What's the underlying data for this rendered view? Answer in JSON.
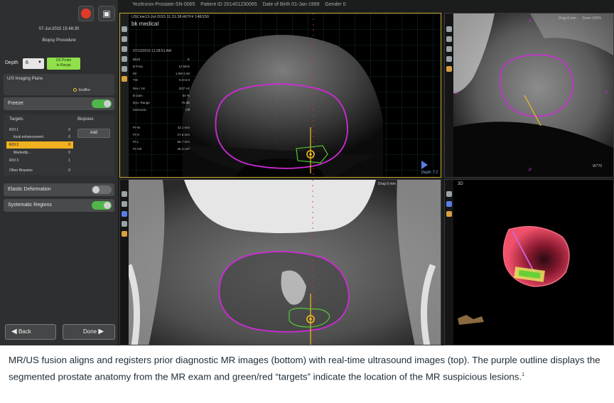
{
  "window": {
    "title": "Yezitronix-Prostate-SN-0065",
    "patient_id": "Patient ID 201401230065",
    "dob": "Date of Birth 01-Jan-1999",
    "gender": "Gender 0"
  },
  "panel": {
    "date": "07-Jul-2015 15:48:30",
    "procedure": "Biopsy Procedure",
    "camera_icon": "camera-icon",
    "depth_label": "Depth",
    "depth_value": "6",
    "probe_badge_line1": "US Probe",
    "probe_badge_line2": "In Range",
    "imaging_plane_title": "U/S Imaging Plane",
    "imaging_plane_option": "Endfire",
    "freeze_label": "Freeze",
    "freeze_on": true,
    "targets_header": "Targets",
    "biopsies_header": "Biopsies",
    "add_label": "Add",
    "targets": [
      {
        "name": "ROI 1",
        "count": "0",
        "selected": false
      },
      {
        "name": "local enhancement",
        "count": "0",
        "selected": false
      },
      {
        "name": "ROI 2",
        "count": "0",
        "selected": true
      },
      {
        "name": "Markedly...",
        "count": "0",
        "selected": false
      },
      {
        "name": "ROI 3",
        "count": "1",
        "selected": false
      },
      {
        "name": "Other Biopsies",
        "count": "0",
        "selected": false
      }
    ],
    "elastic_label": "Elastic Deformation",
    "elastic_on": false,
    "systematic_label": "Systematic Regions",
    "systematic_on": true,
    "back_label": "Back",
    "done_label": "Done"
  },
  "ultrasound": {
    "header": "USCine13-Jul-2015 11:31:38.407F# 148/150",
    "brand": "bk medical",
    "timestamp": "07/13/2015 11:28:51 AM",
    "params": [
      {
        "k": "8818",
        "v": "E"
      },
      {
        "k": "B Freq",
        "v": "12 MHz"
      },
      {
        "k": "MI",
        "v": "1.09<1.50"
      },
      {
        "k": "TIS",
        "v": "0.2<2.0"
      },
      {
        "k": "Res / Hz",
        "v": "2/37 Hz"
      },
      {
        "k": "B Gain",
        "v": "50 %"
      },
      {
        "k": "Dyn. Range",
        "v": "75 dB"
      },
      {
        "k": "Harmonic",
        "v": "Off"
      }
    ],
    "measures": [
      {
        "k": "Pr-W",
        "v": "43.1 mm"
      },
      {
        "k": "Pr-H",
        "v": "27.6 mm"
      },
      {
        "k": "Pr-L",
        "v": "56.7 mm"
      },
      {
        "k": "Pr-Vol",
        "v": "35.3 cm³"
      }
    ],
    "depth_readout": "Depth: 7.2"
  },
  "sagittal": {
    "drag": "Drag 6 mm",
    "zoom": "Zoom 142%",
    "labels": {
      "top": "A",
      "bottom": "P",
      "left": "H",
      "right": "F"
    },
    "corner": "W770"
  },
  "axial_mr": {
    "drag": "Drag 6 mm"
  },
  "view3d": {
    "label": "3D"
  },
  "caption": {
    "text": "MR/US fusion aligns and registers prior diagnostic MR images (bottom) with real-time ultrasound images (top). The purple outline displays the segmented prostate anatomy from the MR exam and green/red “targets” indicate the location of the MR suspicious lesions.",
    "footnote": "1"
  },
  "colors": {
    "prostate_outline": "#d02ad8",
    "target_green": "#58d232",
    "target_red": "#e23030",
    "needle": "#f0c020",
    "toggle_on": "#4fb64a",
    "probe_badge": "#8fe04a"
  }
}
